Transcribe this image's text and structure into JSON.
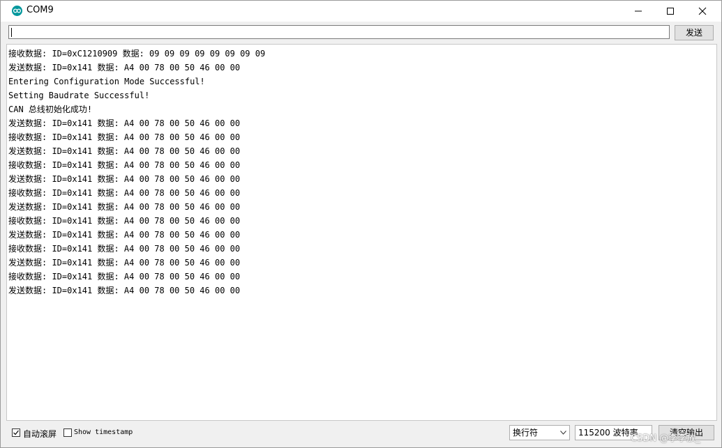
{
  "window": {
    "title": "COM9",
    "icon": "arduino-icon",
    "controls": [
      "minimize-icon",
      "maximize-icon",
      "close-icon"
    ]
  },
  "send_bar": {
    "input_value": "",
    "send_label": "发送"
  },
  "serial_log": [
    "接收数据: ID=0xC1210909 数据: 09 09 09 09 09 09 09 09",
    "发送数据: ID=0x141 数据: A4 00 78 00 50 46 00 00",
    "Entering Configuration Mode Successful!",
    "Setting Baudrate Successful!",
    "CAN 总线初始化成功!",
    "发送数据: ID=0x141 数据: A4 00 78 00 50 46 00 00",
    "接收数据: ID=0x141 数据: A4 00 78 00 50 46 00 00",
    "发送数据: ID=0x141 数据: A4 00 78 00 50 46 00 00",
    "接收数据: ID=0x141 数据: A4 00 78 00 50 46 00 00",
    "发送数据: ID=0x141 数据: A4 00 78 00 50 46 00 00",
    "接收数据: ID=0x141 数据: A4 00 78 00 50 46 00 00",
    "发送数据: ID=0x141 数据: A4 00 78 00 50 46 00 00",
    "接收数据: ID=0x141 数据: A4 00 78 00 50 46 00 00",
    "发送数据: ID=0x141 数据: A4 00 78 00 50 46 00 00",
    "接收数据: ID=0x141 数据: A4 00 78 00 50 46 00 00",
    "发送数据: ID=0x141 数据: A4 00 78 00 50 46 00 00",
    "接收数据: ID=0x141 数据: A4 00 78 00 50 46 00 00",
    "发送数据: ID=0x141 数据: A4 00 78 00 50 46 00 00"
  ],
  "footer": {
    "autoscroll_label": "自动滚屏",
    "autoscroll_checked": true,
    "timestamp_label": "Show timestamp",
    "timestamp_checked": false,
    "line_ending_value": "换行符",
    "baud_value": "115200 波特率",
    "clear_label": "清空输出",
    "watermark": "CSDN @李李放_"
  },
  "colors": {
    "accent": "#00979c",
    "titlebar": "#ffffff",
    "chrome": "#f0f0f0"
  }
}
